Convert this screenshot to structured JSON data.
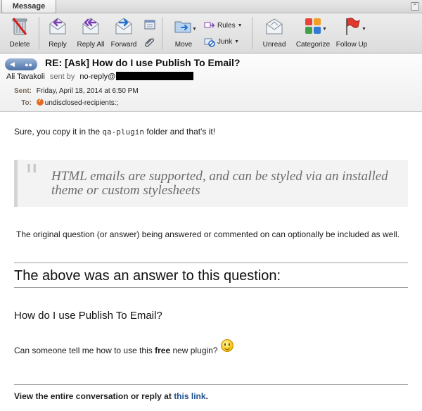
{
  "ribbon": {
    "tab_label": "Message",
    "buttons": {
      "delete": "Delete",
      "reply": "Reply",
      "reply_all": "Reply All",
      "forward": "Forward",
      "move": "Move",
      "rules": "Rules",
      "junk": "Junk",
      "unread": "Unread",
      "categorize": "Categorize",
      "follow_up": "Follow Up"
    }
  },
  "header": {
    "subject": "RE: [Ask] How do I use Publish To Email?",
    "sender_name": "Ali Tavakoli",
    "sent_by_label": "sent by",
    "sender_email_prefix": "no-reply@",
    "sent_label": "Sent:",
    "sent_value": "Friday, April 18, 2014 at 6:50 PM",
    "to_label": "To:",
    "to_value": "undisclosed-recipients:;"
  },
  "body": {
    "line1_before": "Sure, you copy it in the ",
    "line1_code": "qa-plugin",
    "line1_after": " folder and that's it!",
    "quote": "HTML emails are supported, and can be styled via an installed theme or custom stylesheets",
    "paragraph": "The original question (or answer) being answered or commented on can optionally be included as well.",
    "section_heading": "The above was an answer to this question:",
    "question_title": "How do I use Publish To Email?",
    "question_before": "Can someone tell me how to use this ",
    "question_bold": "free",
    "question_after": " new plugin?",
    "footer_before": "View the entire conversation or reply at ",
    "footer_link": "this link",
    "footer_after": "."
  },
  "colors": {
    "link": "#1f4f93",
    "header_label": "#7a6b5a",
    "quote_text": "#6c6c6c"
  }
}
